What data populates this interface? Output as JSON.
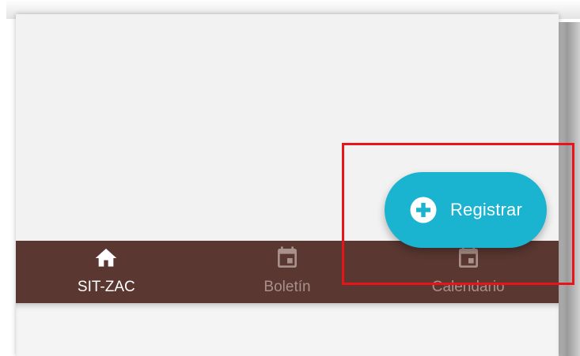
{
  "fab": {
    "label": "Registrar",
    "icon": "plus-circle-icon",
    "color": "#1ab3d0"
  },
  "bottom_nav": {
    "background": "#5a3731",
    "items": [
      {
        "label": "SIT-ZAC",
        "icon": "home-icon",
        "active": true
      },
      {
        "label": "Boletín",
        "icon": "calendar-icon",
        "active": false
      },
      {
        "label": "Calendario",
        "icon": "calendar-icon",
        "active": false
      }
    ]
  },
  "highlight": {
    "color": "#e8141a"
  }
}
